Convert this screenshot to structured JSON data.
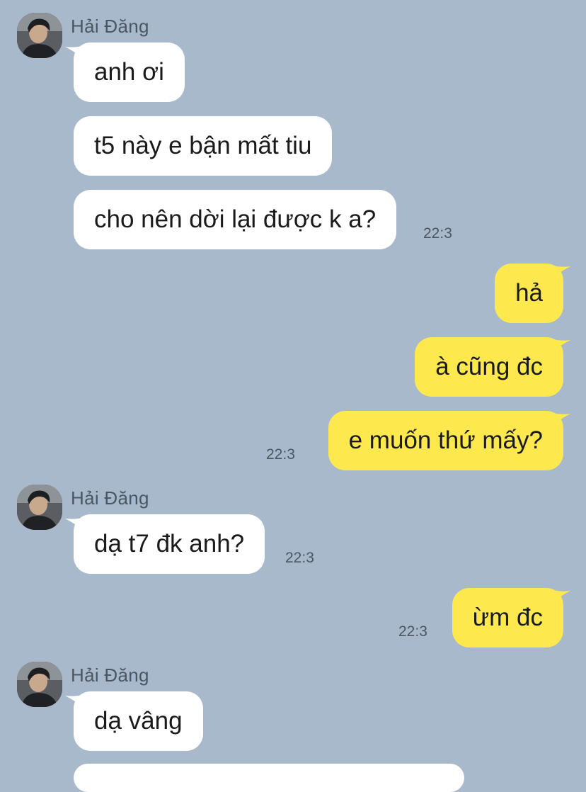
{
  "contact": {
    "name": "Hải Đăng"
  },
  "colors": {
    "background": "#a9b9cc",
    "incoming_bubble": "#ffffff",
    "outgoing_bubble": "#fde84e"
  },
  "messages": [
    {
      "direction": "in",
      "text": "anh ơi"
    },
    {
      "direction": "in",
      "text": "t5 này e bận mất tiu"
    },
    {
      "direction": "in",
      "text": "cho nên dời lại được k a?",
      "time": "22:3"
    },
    {
      "direction": "out",
      "text": "hả"
    },
    {
      "direction": "out",
      "text": "à cũng đc"
    },
    {
      "direction": "out",
      "text": "e muốn thứ mấy?",
      "time": "22:3"
    },
    {
      "direction": "in",
      "text": "dạ t7 đk anh?",
      "time": "22:3"
    },
    {
      "direction": "out",
      "text": "ừm đc",
      "time": "22:3"
    },
    {
      "direction": "in",
      "text": "dạ vâng"
    }
  ],
  "icons": {
    "avatar": "contact-avatar-photo"
  }
}
